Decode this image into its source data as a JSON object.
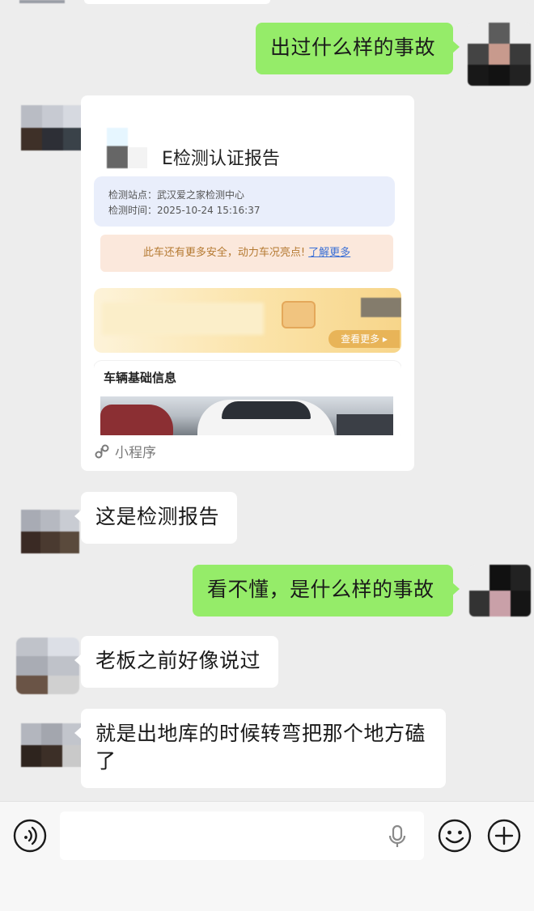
{
  "messages": [
    {
      "side": "right",
      "text": "出过什么样的事故"
    },
    {
      "side": "left",
      "type": "mini_program",
      "card": {
        "title": "E检测认证报告",
        "station_label": "检测站点：",
        "station": "武汉爱之家检测中心",
        "time_label": "检测时间：",
        "time": "2025-10-24 15:16:37",
        "promo_text": "此车还有更多安全，动力车况亮点!",
        "promo_link": "了解更多",
        "banner_more": "查看更多 ▸",
        "section_title": "车辆基础信息",
        "footer": "小程序"
      }
    },
    {
      "side": "left",
      "text": "这是检测报告"
    },
    {
      "side": "right",
      "text": "看不懂，是什么样的事故"
    },
    {
      "side": "left",
      "text": "老板之前好像说过"
    },
    {
      "side": "left",
      "text_line1": "就是出地库的时候转弯把那个地方磕",
      "text_line2": "了"
    }
  ],
  "input_bar": {
    "left_icon": "voice-icon",
    "field_mic_icon": "mic-icon",
    "emoji_icon": "emoji-icon",
    "plus_icon": "plus-icon"
  },
  "colors": {
    "background": "#ededed",
    "bubble_me": "#95ec69",
    "bubble_other": "#ffffff"
  }
}
